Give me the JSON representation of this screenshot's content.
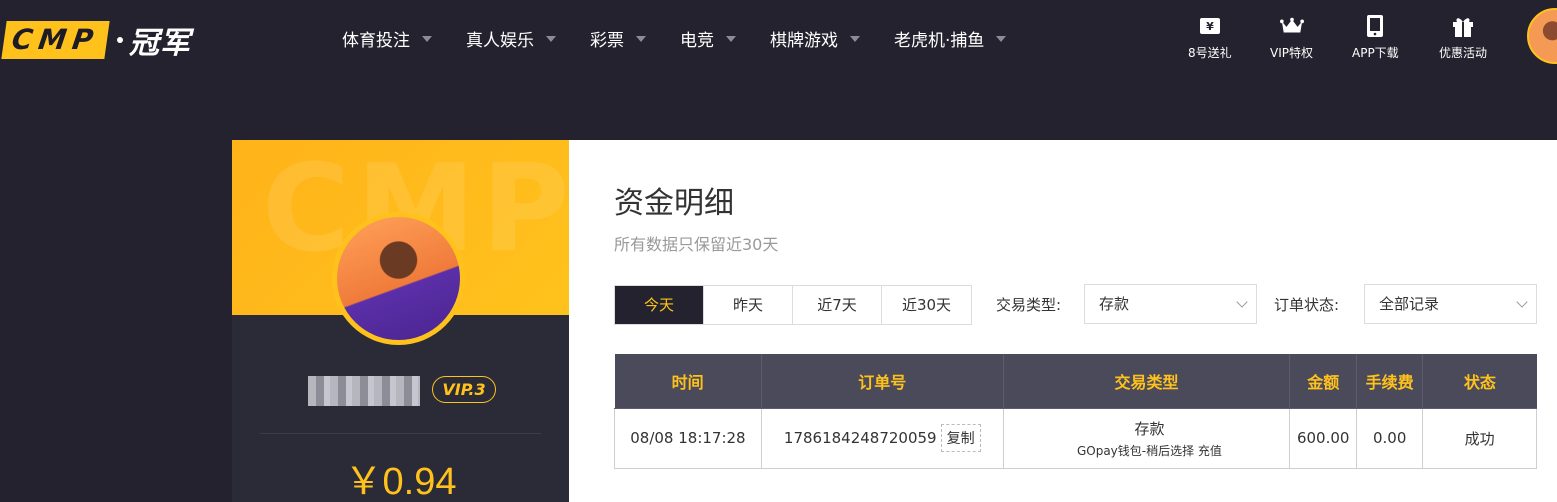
{
  "header": {
    "logo_box": "CMP",
    "logo_text": "冠军",
    "nav": [
      {
        "label": "体育投注"
      },
      {
        "label": "真人娱乐"
      },
      {
        "label": "彩票"
      },
      {
        "label": "电竞"
      },
      {
        "label": "棋牌游戏"
      },
      {
        "label": "老虎机·捕鱼"
      }
    ],
    "quick_links": [
      {
        "label": "8号送礼",
        "icon": "gift-coupon-icon"
      },
      {
        "label": "VIP特权",
        "icon": "crown-icon"
      },
      {
        "label": "APP下载",
        "icon": "mobile-icon"
      },
      {
        "label": "优惠活动",
        "icon": "gift-box-icon"
      }
    ]
  },
  "profile": {
    "watermark": "CMP",
    "vip": "VIP.3",
    "balance": "￥0.94"
  },
  "main": {
    "title": "资金明细",
    "subtitle": "所有数据只保留近30天",
    "tabs": [
      {
        "label": "今天",
        "active": true
      },
      {
        "label": "昨天",
        "active": false
      },
      {
        "label": "近7天",
        "active": false
      },
      {
        "label": "近30天",
        "active": false
      }
    ],
    "filters": {
      "type_label": "交易类型:",
      "type_value": "存款",
      "status_label": "订单状态:",
      "status_value": "全部记录"
    },
    "table": {
      "columns": [
        "时间",
        "订单号",
        "交易类型",
        "金额",
        "手续费",
        "状态"
      ],
      "rows": [
        {
          "time": "08/08 18:17:28",
          "order_no": "1786184248720059",
          "copy_label": "复制",
          "type_main": "存款",
          "type_sub": "GOpay钱包-稍后选择 充值",
          "amount": "600.00",
          "fee": "0.00",
          "status": "成功"
        }
      ]
    }
  },
  "colors": {
    "accent": "#ffc21c",
    "bg_dark": "#23222e",
    "status_success": "#2fa22f"
  }
}
